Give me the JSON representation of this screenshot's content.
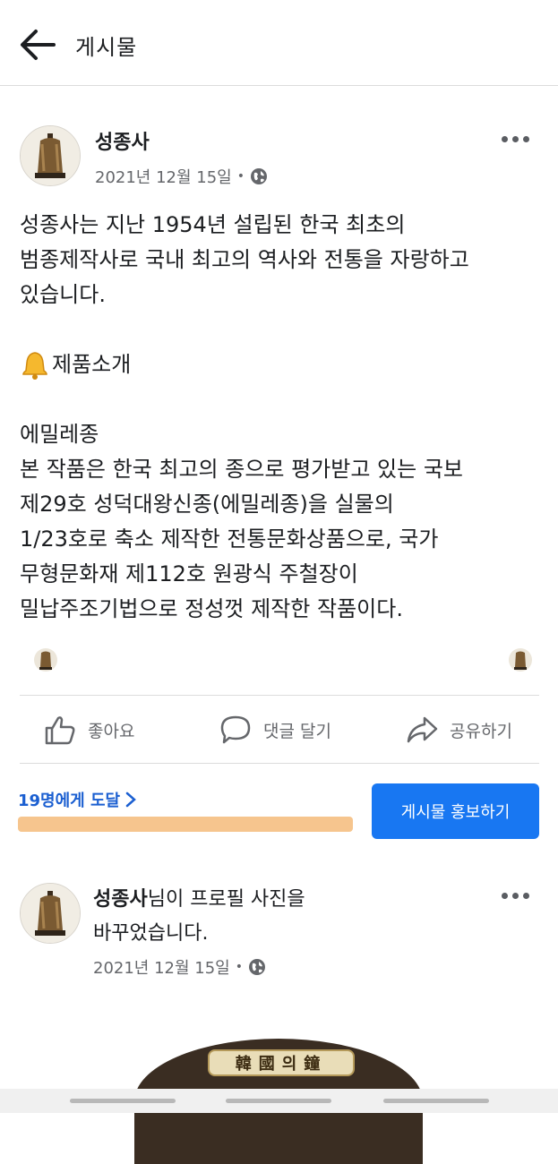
{
  "topbar": {
    "title": "게시물",
    "back_icon": "arrow-left-icon"
  },
  "post": {
    "author": "성종사",
    "date": "2021년 12월 15일",
    "privacy_icon": "globe-icon",
    "more_icon": "more-horizontal-icon",
    "lines": [
      "성종사는 지난 1954년 설립된 한국 최초의",
      "범종제작사로 국내 최고의 역사와 전통을 자랑하고",
      "있습니다."
    ],
    "section_heading": "제품소개",
    "section_icon": "bell-icon",
    "product_name": "에밀레종",
    "product_lines": [
      "본 작품은 한국 최고의 종으로 평가받고 있는 국보",
      "제29호 성덕대왕신종(에밀레종)을 실물의",
      "1/23호로 축소 제작한 전통문화상품으로, 국가",
      "무형문화재 제112호 원광식 주철장이",
      "밀납주조기법으로 정성껏 제작한 작품이다."
    ]
  },
  "actions": {
    "like": "좋아요",
    "comment": "댓글 달기",
    "share": "공유하기"
  },
  "reach": {
    "text": "19명에게 도달",
    "progress": 1.0
  },
  "boost_button": "게시물 홍보하기",
  "post2": {
    "author": "성종사",
    "action_line1": "님이 프로필 사진을",
    "action_line2": "바꾸었습니다.",
    "date": "2021년 12월 15일",
    "photo_plate": "韓國의鐘"
  },
  "colors": {
    "accent": "#1877f2",
    "reach_bar": "#f6c58e",
    "link": "#1b5fd1"
  }
}
